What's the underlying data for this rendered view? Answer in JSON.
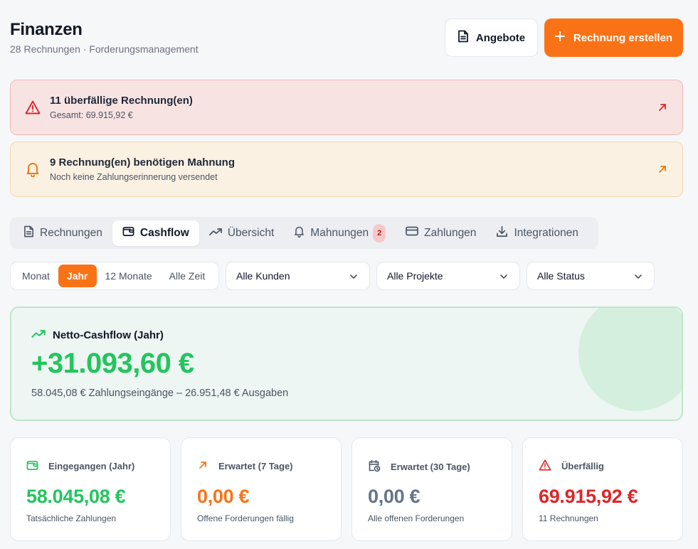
{
  "header": {
    "title": "Finanzen",
    "subtitle": "28 Rechnungen · Forderungsmanagement",
    "offers_label": "Angebote",
    "create_label": "Rechnung erstellen"
  },
  "alerts": {
    "overdue": {
      "title": "11 überfällige Rechnung(en)",
      "sub": "Gesamt: 69.915,92 €"
    },
    "reminder": {
      "title": "9 Rechnung(en) benötigen Mahnung",
      "sub": "Noch keine Zahlungserinnerung versendet"
    }
  },
  "tabs": [
    {
      "label": "Rechnungen",
      "icon": "document-icon"
    },
    {
      "label": "Cashflow",
      "icon": "wallet-icon",
      "active": true
    },
    {
      "label": "Übersicht",
      "icon": "trending-up-icon"
    },
    {
      "label": "Mahnungen",
      "icon": "bell-icon",
      "badge": "2"
    },
    {
      "label": "Zahlungen",
      "icon": "credit-card-icon"
    },
    {
      "label": "Integrationen",
      "icon": "download-icon"
    }
  ],
  "period": {
    "options": [
      "Monat",
      "Jahr",
      "12 Monate",
      "Alle Zeit"
    ],
    "selected": "Jahr"
  },
  "filters": {
    "customers": "Alle Kunden",
    "projects": "Alle Projekte",
    "status": "Alle Status"
  },
  "hero": {
    "label": "Netto-Cashflow (Jahr)",
    "value": "+31.093,60 €",
    "sub": "58.045,08 € Zahlungseingänge – 26.951,48 € Ausgaben"
  },
  "cards": [
    {
      "title": "Eingegangen (Jahr)",
      "value": "58.045,08 €",
      "sub": "Tatsächliche Zahlungen",
      "color": "#22c55e",
      "icon": "wallet-icon"
    },
    {
      "title": "Erwartet (7 Tage)",
      "value": "0,00 €",
      "sub": "Offene Forderungen fällig",
      "color": "#f97316",
      "icon": "arrow-up-right-icon"
    },
    {
      "title": "Erwartet (30 Tage)",
      "value": "0,00 €",
      "sub": "Alle offenen Forderungen",
      "color": "#64748b",
      "icon": "calendar-clock-icon"
    },
    {
      "title": "Überfällig",
      "value": "69.915,92 €",
      "sub": "11 Rechnungen",
      "color": "#dc2626",
      "icon": "alert-triangle-icon"
    }
  ],
  "colors": {
    "accent": "#f97316",
    "positive": "#22c55e",
    "danger": "#dc2626",
    "neutral": "#64748b"
  }
}
